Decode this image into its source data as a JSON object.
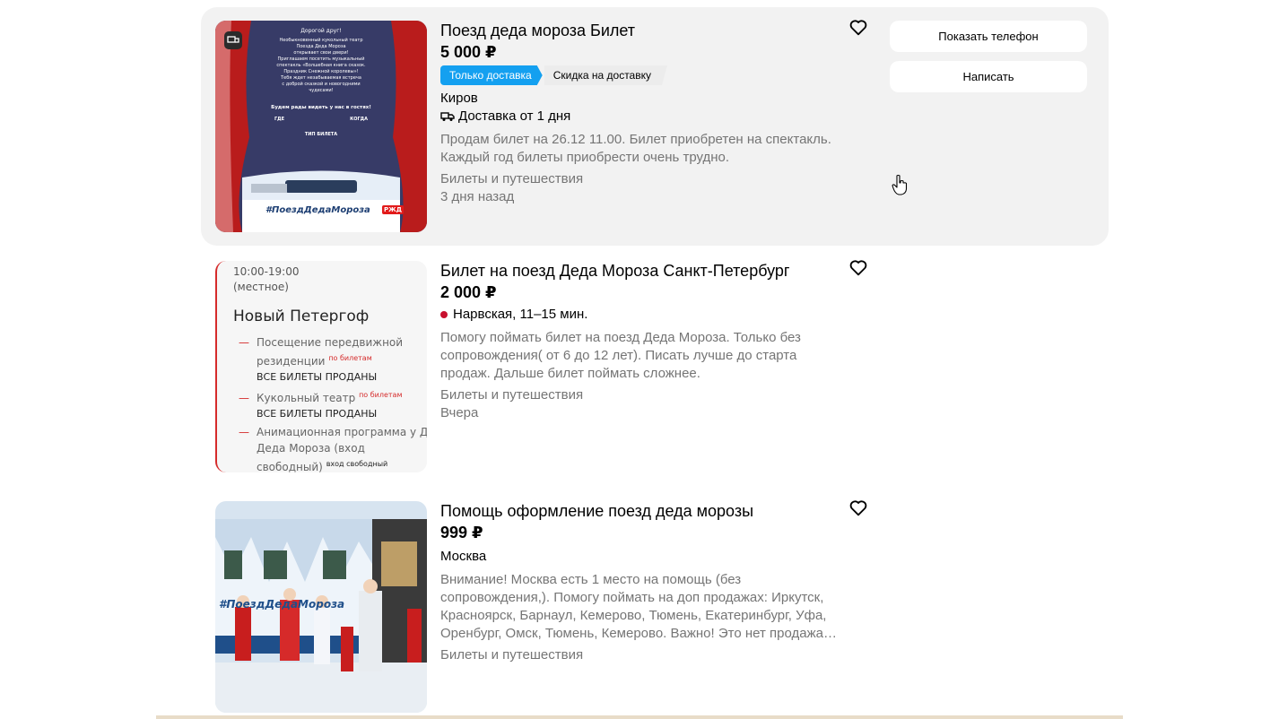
{
  "listings": [
    {
      "title": "Поезд деда мороза Билет",
      "price": "5 000 ₽",
      "badges": [
        "Только доставка",
        "Скидка на доставку"
      ],
      "location": "Киров",
      "delivery": "Доставка от 1 дня",
      "description_line1": "Продам билет на 26.12 11.00. Билет приобретен на спектакль.",
      "description_line2": "Каждый год билеты приобрести очень трудно.",
      "category": "Билеты и путешествия",
      "date": "3 дня назад",
      "actions": {
        "phone": "Показать телефон",
        "write": "Написать"
      },
      "image": {
        "greeting": "Дорогой друг!",
        "poster_lines": [
          "Необыкновенный кукольный театр",
          "Поезда Деда Мороза",
          "открывает свои двери!",
          "Приглашаем посетить музыкальный",
          "спектакль «Волшебная книга сказок.",
          "Праздник Снежной королевы»!",
          "Тебя ждет незабываемая встреча",
          "с доброй сказкой и новогодними",
          "чудесами!"
        ],
        "invite": "Будем рады видеть у нас в гостях!",
        "where": "ГДЕ",
        "when": "КОГДА",
        "ticket_type": "ТИП БИЛЕТА",
        "hashtag": "#ПоездДедаМороза",
        "brand": "РЖД"
      }
    },
    {
      "title": "Билет на поезд Деда Мороза Санкт-Петербург",
      "price": "2 000 ₽",
      "metro": "Нарвская, 11–15 мин.",
      "description_line1": "Помогу поймать билет на поезд Деда Мороза. Только без",
      "description_line2": "сопровождения( от 6 до 12 лет). Писать лучше до старта",
      "description_line3": "продаж. Дальше билет поймать сложнее.",
      "category": "Билеты и путешествия",
      "date": "Вчера",
      "image": {
        "time": "10:00-19:00",
        "time_note": "(местное)",
        "city": "Новый Петергоф",
        "item1a": "Посещение передвижной",
        "item1b": "резиденции",
        "item1_tag": "по билетам",
        "item1_status": "ВСЕ БИЛЕТЫ ПРОДАНЫ",
        "item2": "Кукольный театр",
        "item2_tag": "по билетам",
        "item2_status": "ВСЕ БИЛЕТЫ ПРОДАНЫ",
        "item3a": "Анимационная программа у Д",
        "item3b": "Деда Мороза (вход",
        "item3c": "свободный)",
        "item3_tag": "вход свободный"
      }
    },
    {
      "title": "Помощь оформление поезд деда морозы",
      "price": "999 ₽",
      "location": "Москва",
      "description_line1": "Внимание! Москва есть 1 место на помощь (без",
      "description_line2": "сопровождения,). Помогу поймать на доп продажах: Иркутск,",
      "description_line3": "Красноярск, Барнаул, Кемерово, Тюмень, Екатеринбург, Уфа,",
      "description_line4": "Оренбург, Омск, Тюмень, Кемерово. Важно! Это нет продажа…",
      "category": "Билеты и путешествия",
      "image": {
        "train_text": "#ПоездДедаМороза"
      }
    }
  ],
  "colors": {
    "badge_blue": "#14a0f0",
    "metro_red": "#c8102e",
    "muted_text": "#757575",
    "card_hover_bg": "#f2f2f2"
  },
  "icons": {
    "favorite": "heart-outline-icon",
    "delivery": "truck-icon",
    "cursor": "hand-pointer-icon"
  }
}
